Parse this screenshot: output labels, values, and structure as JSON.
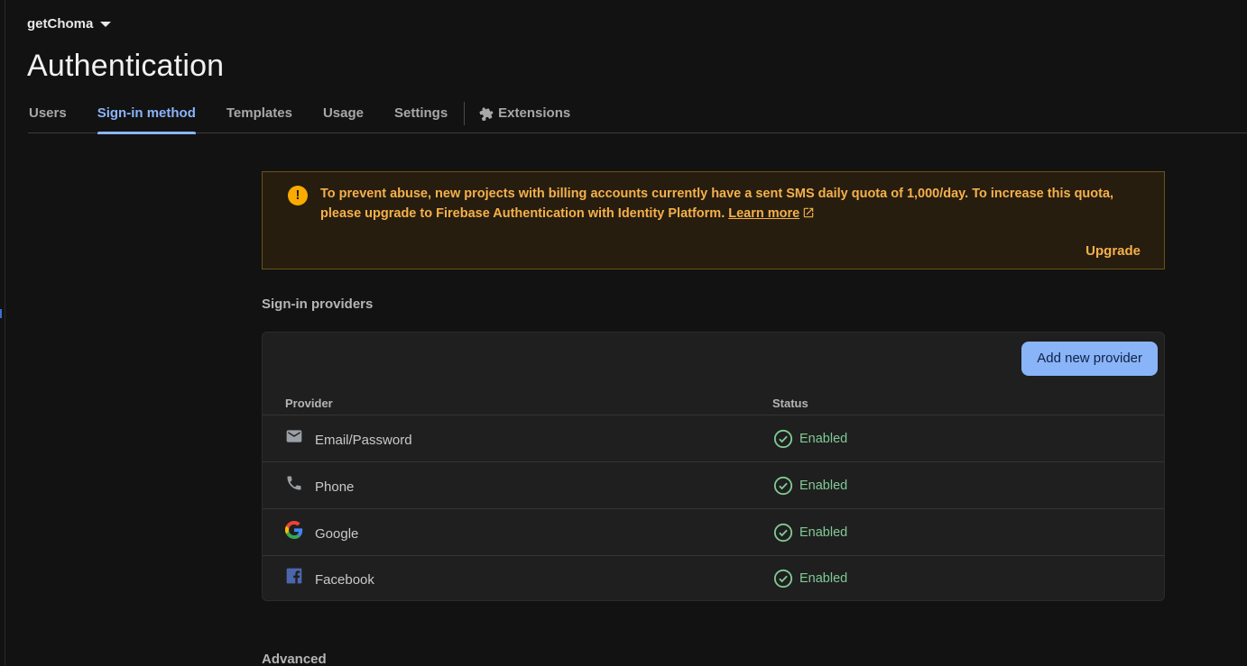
{
  "project": {
    "name": "getChoma"
  },
  "page": {
    "title": "Authentication"
  },
  "tabs": [
    {
      "label": "Users",
      "active": false
    },
    {
      "label": "Sign-in method",
      "active": true
    },
    {
      "label": "Templates",
      "active": false
    },
    {
      "label": "Usage",
      "active": false
    },
    {
      "label": "Settings",
      "active": false
    },
    {
      "label": "Extensions",
      "active": false,
      "icon": "puzzle-icon"
    }
  ],
  "banner": {
    "icon": "warning-icon",
    "message": "To prevent abuse, new projects with billing accounts currently have a sent SMS daily quota of 1,000/day. To increase this quota, please upgrade to Firebase Authentication with Identity Platform.",
    "link_label": "Learn more",
    "action_label": "Upgrade",
    "color": "#f6b04a"
  },
  "providers_section": {
    "label": "Sign-in providers",
    "add_button": "Add new provider",
    "columns": [
      "Provider",
      "Status"
    ],
    "rows": [
      {
        "name": "Email/Password",
        "icon": "email-icon",
        "status": "Enabled"
      },
      {
        "name": "Phone",
        "icon": "phone-icon",
        "status": "Enabled"
      },
      {
        "name": "Google",
        "icon": "google-icon",
        "status": "Enabled"
      },
      {
        "name": "Facebook",
        "icon": "facebook-icon",
        "status": "Enabled"
      }
    ]
  },
  "advanced_section": {
    "label": "Advanced"
  },
  "colors": {
    "accent": "#8ab4f8",
    "enabled": "#81c995",
    "warning": "#f9ab00"
  }
}
